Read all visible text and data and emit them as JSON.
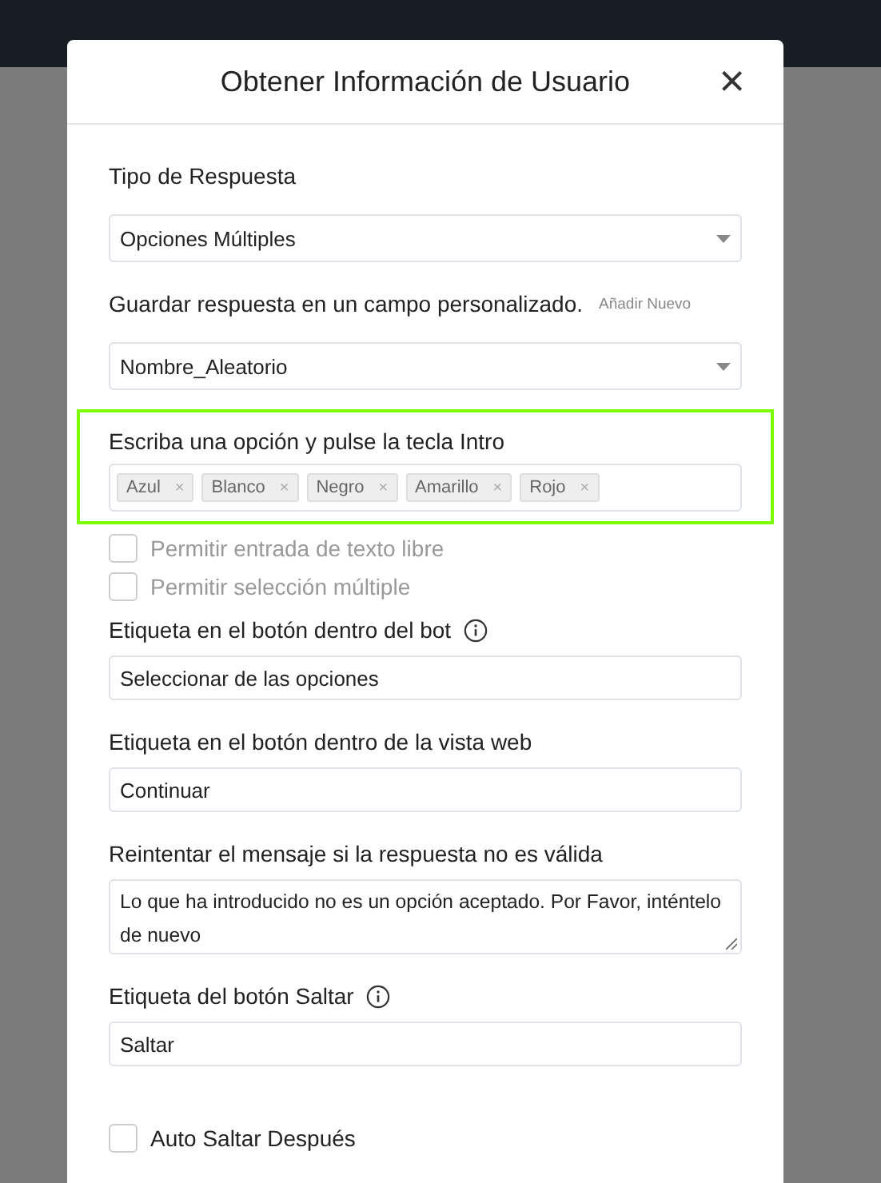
{
  "dialog": {
    "title": "Obtener Información de Usuario",
    "close": "×"
  },
  "fields": [
    {
      "kind": "select",
      "label": "Tipo de Respuesta",
      "value": "Opciones Múltiples"
    },
    {
      "kind": "select",
      "label": "Guardar respuesta en un campo personalizado.",
      "link": "Añadir Nuevo",
      "value": "Nombre_Aleatorio"
    },
    {
      "kind": "tags",
      "label": "Escriba una opción y pulse la tecla Intro",
      "highlighted": true,
      "tags": [
        "Azul",
        "Blanco",
        "Negro",
        "Amarillo",
        "Rojo"
      ],
      "remove": "×"
    },
    {
      "kind": "checkbox",
      "label": "Permitir entrada de texto libre",
      "checked": false,
      "disabled": true
    },
    {
      "kind": "checkbox",
      "label": "Permitir selección múltiple",
      "checked": false,
      "disabled": true
    },
    {
      "kind": "text",
      "label": "Etiqueta en el botón dentro del bot",
      "info": true,
      "value": "Seleccionar de las opciones"
    },
    {
      "kind": "text",
      "label": "Etiqueta en el botón dentro de la vista web",
      "info": false,
      "value": "Continuar"
    },
    {
      "kind": "textarea",
      "label": "Reintentar el mensaje si la respuesta no es válida",
      "value": "Lo que ha introducido no es un opción aceptado. Por Favor, inténtelo de nuevo"
    },
    {
      "kind": "text",
      "label": "Etiqueta del botón Saltar",
      "info": true,
      "value": "Saltar"
    },
    {
      "kind": "checkbox",
      "label": "Auto Saltar Después",
      "checked": false,
      "disabled": false
    }
  ]
}
